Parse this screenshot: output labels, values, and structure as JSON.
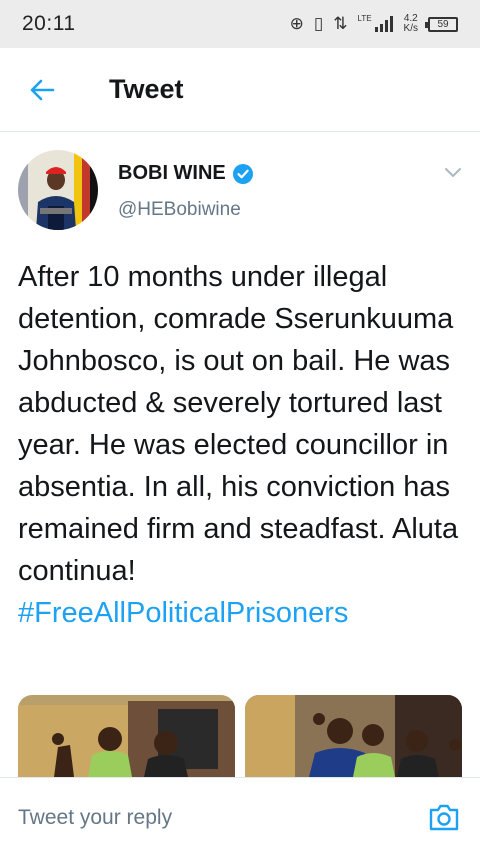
{
  "status_bar": {
    "time": "20:11",
    "icons": [
      "add-circle-icon",
      "vibrate-icon",
      "data-arrows-icon",
      "signal-icon",
      "battery-icon"
    ],
    "network_type": "LTE",
    "speed_value": "4.2",
    "speed_unit": "K/s",
    "battery_level": "59"
  },
  "header": {
    "title": "Tweet",
    "back_icon": "arrow-left-icon",
    "accent_color": "#1da1f2"
  },
  "author": {
    "display_name": "BOBI WINE",
    "handle": "@HEBobiwine",
    "verified": true
  },
  "tweet": {
    "text": "After 10 months under illegal detention, comrade Sserunkuuma Johnbosco, is out on bail. He was abducted & severely tortured last year. He was elected councillor in absentia. In all, his conviction has remained firm and steadfast. Aluta continua!",
    "hashtag": "#FreeAllPoliticalPrisoners"
  },
  "media": {
    "count": 2
  },
  "reply": {
    "placeholder": "Tweet your reply",
    "camera_icon": "camera-icon"
  },
  "colors": {
    "link": "#1da1f2",
    "secondary_text": "#657786",
    "divider": "#e1e8ed"
  }
}
